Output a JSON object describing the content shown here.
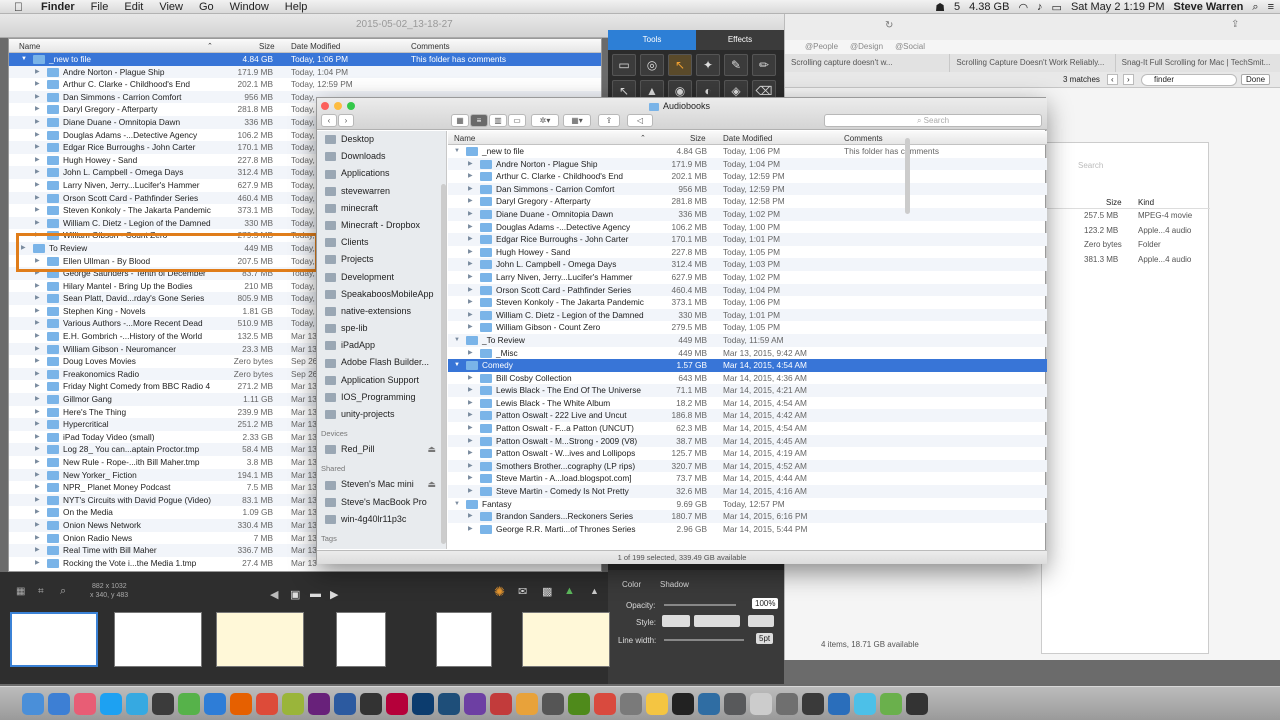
{
  "menubar": {
    "apple": "",
    "items": [
      "Finder",
      "File",
      "Edit",
      "View",
      "Go",
      "Window",
      "Help"
    ],
    "status": {
      "storage": "4.38 GB",
      "badge": "5",
      "date_time": "Sat May 2  1:19 PM",
      "user": "Steve Warren"
    }
  },
  "capture_title": "2015-05-02_13-18-27",
  "browser": {
    "bookmarks": [
      "@People",
      "@Design",
      "@Social"
    ],
    "tabs": [
      "Scrolling capture doesn't w...",
      "Scrolling Capture Doesn't Work Reliably...",
      "Snag-It Full Scrolling for Mac | TechSmit..."
    ],
    "find": {
      "matches": "3 matches",
      "query": "finder",
      "done": "Done"
    },
    "search_placeholder": "Search",
    "columns": {
      "size": "Size",
      "kind": "Kind"
    },
    "rows": [
      {
        "size": "257.5 MB",
        "kind": "MPEG-4 movie"
      },
      {
        "size": "123.2 MB",
        "kind": "Apple...4 audio"
      },
      {
        "size": "Zero bytes",
        "kind": "Folder"
      },
      {
        "size": "381.3 MB",
        "kind": "Apple...4 audio"
      }
    ],
    "footer": "4 items, 18.71 GB available"
  },
  "list_window": {
    "columns": {
      "name": "Name",
      "size": "Size",
      "date": "Date Modified",
      "comments": "Comments"
    },
    "rows": [
      {
        "name": "_new to file",
        "size": "4.84 GB",
        "date": "Today, 1:06 PM",
        "comment": "This folder has comments",
        "level": 0,
        "open": true,
        "sel": true
      },
      {
        "name": "Andre Norton - Plague Ship",
        "size": "171.9 MB",
        "date": "Today, 1:04 PM",
        "level": 1
      },
      {
        "name": "Arthur C. Clarke - Childhood's End",
        "size": "202.1 MB",
        "date": "Today, 12:59 PM",
        "level": 1
      },
      {
        "name": "Dan Simmons - Carrion Comfort",
        "size": "956 MB",
        "date": "Today,",
        "level": 1
      },
      {
        "name": "Daryl Gregory - Afterparty",
        "size": "281.8 MB",
        "date": "Today,",
        "level": 1
      },
      {
        "name": "Diane Duane - Omnitopia Dawn",
        "size": "336 MB",
        "date": "Today,",
        "level": 1
      },
      {
        "name": "Douglas Adams -...Detective Agency",
        "size": "106.2 MB",
        "date": "Today,",
        "level": 1
      },
      {
        "name": "Edgar Rice Burroughs - John Carter",
        "size": "170.1 MB",
        "date": "Today,",
        "level": 1
      },
      {
        "name": "Hugh Howey - Sand",
        "size": "227.8 MB",
        "date": "Today,",
        "level": 1
      },
      {
        "name": "John L. Campbell - Omega Days",
        "size": "312.4 MB",
        "date": "Today,",
        "level": 1
      },
      {
        "name": "Larry Niven, Jerry...Lucifer's Hammer",
        "size": "627.9 MB",
        "date": "Today,",
        "level": 1
      },
      {
        "name": "Orson Scott Card - Pathfinder Series",
        "size": "460.4 MB",
        "date": "Today,",
        "level": 1
      },
      {
        "name": "Steven Konkoly - The Jakarta Pandemic",
        "size": "373.1 MB",
        "date": "Today,",
        "level": 1
      },
      {
        "name": "William C. Dietz - Legion of the Damned",
        "size": "330 MB",
        "date": "Today,",
        "level": 1
      },
      {
        "name": "William Gibson - Count Zero",
        "size": "279.5 MB",
        "date": "Today,",
        "level": 1
      },
      {
        "name": "To Review",
        "size": "449 MB",
        "date": "Today,",
        "level": 0
      },
      {
        "name": "Ellen Ullman - By Blood",
        "size": "207.5 MB",
        "date": "Today,",
        "level": 1
      },
      {
        "name": "George Saunders - Tenth of December",
        "size": "83.7 MB",
        "date": "Today,",
        "level": 1
      },
      {
        "name": "Hilary Mantel - Bring Up the Bodies",
        "size": "210 MB",
        "date": "Today,",
        "level": 1
      },
      {
        "name": "Sean Platt, David...rday's Gone Series",
        "size": "805.9 MB",
        "date": "Today,",
        "level": 1
      },
      {
        "name": "Stephen King - Novels",
        "size": "1.81 GB",
        "date": "Today,",
        "level": 1
      },
      {
        "name": "Various Authors -...More Recent Dead",
        "size": "510.9 MB",
        "date": "Today,",
        "level": 1
      },
      {
        "name": "E.H. Gombrich -...History of the World",
        "size": "132.5 MB",
        "date": "Mar 13",
        "level": 1
      },
      {
        "name": "William Gibson - Neuromancer",
        "size": "23.3 MB",
        "date": "Mar 13",
        "level": 1
      },
      {
        "name": "Doug Loves Movies",
        "size": "Zero bytes",
        "date": "Sep 26",
        "level": 1
      },
      {
        "name": "Freakonomics Radio",
        "size": "Zero bytes",
        "date": "Sep 26",
        "level": 1
      },
      {
        "name": "Friday Night Comedy from BBC Radio 4",
        "size": "271.2 MB",
        "date": "Mar 13",
        "level": 1
      },
      {
        "name": "Gillmor Gang",
        "size": "1.11 GB",
        "date": "Mar 13",
        "level": 1
      },
      {
        "name": "Here's The Thing",
        "size": "239.9 MB",
        "date": "Mar 13",
        "level": 1
      },
      {
        "name": "Hypercritical",
        "size": "251.2 MB",
        "date": "Mar 13",
        "level": 1
      },
      {
        "name": "iPad Today Video (small)",
        "size": "2.33 GB",
        "date": "Mar 13",
        "level": 1
      },
      {
        "name": "Log 28_ You can...aptain Proctor.tmp",
        "size": "58.4 MB",
        "date": "Mar 13",
        "level": 1
      },
      {
        "name": "New Rule - Rope-...ith Bill Maher.tmp",
        "size": "3.8 MB",
        "date": "Mar 13",
        "level": 1
      },
      {
        "name": "New Yorker_ Fiction",
        "size": "194.1 MB",
        "date": "Mar 13",
        "level": 1
      },
      {
        "name": "NPR_ Planet Money Podcast",
        "size": "7.5 MB",
        "date": "Mar 13",
        "level": 1
      },
      {
        "name": "NYT's Circuits with David Pogue (Video)",
        "size": "83.1 MB",
        "date": "Mar 13",
        "level": 1
      },
      {
        "name": "On the Media",
        "size": "1.09 GB",
        "date": "Mar 13",
        "level": 1
      },
      {
        "name": "Onion News Network",
        "size": "330.4 MB",
        "date": "Mar 13",
        "level": 1
      },
      {
        "name": "Onion Radio News",
        "size": "7 MB",
        "date": "Mar 13",
        "level": 1
      },
      {
        "name": "Real Time with Bill Maher",
        "size": "336.7 MB",
        "date": "Mar 13",
        "level": 1
      },
      {
        "name": "Rocking the Vote i...the Media 1.tmp",
        "size": "27.4 MB",
        "date": "Mar 13",
        "level": 1
      }
    ]
  },
  "snagit": {
    "tabs": {
      "tools": "Tools",
      "effects": "Effects"
    },
    "tools": [
      "▭",
      "◎",
      "↖",
      "✦",
      "✎",
      "✏",
      "↖",
      "▲",
      "◉",
      "◐",
      "◈",
      "⌫"
    ],
    "props": {
      "color": "Color",
      "shadow": "Shadow",
      "opacity": "Opacity:",
      "opacity_val": "100%",
      "style": "Style:",
      "line_width": "Line width:",
      "line_val": "5pt"
    },
    "info": {
      "dims": "882 x 1032",
      "cursor": "x 340, y 483"
    }
  },
  "audiobooks": {
    "title": "Audiobooks",
    "search_placeholder": "Search",
    "sidebar": [
      {
        "type": "item",
        "label": "Desktop"
      },
      {
        "type": "item",
        "label": "Downloads"
      },
      {
        "type": "item",
        "label": "Applications"
      },
      {
        "type": "item",
        "label": "stevewarren"
      },
      {
        "type": "item",
        "label": "minecraft"
      },
      {
        "type": "item",
        "label": "Minecraft - Dropbox"
      },
      {
        "type": "item",
        "label": "Clients"
      },
      {
        "type": "item",
        "label": "Projects"
      },
      {
        "type": "item",
        "label": "Development"
      },
      {
        "type": "item",
        "label": "SpeakaboosMobileApp"
      },
      {
        "type": "item",
        "label": "native-extensions"
      },
      {
        "type": "item",
        "label": "spe-lib"
      },
      {
        "type": "item",
        "label": "iPadApp"
      },
      {
        "type": "item",
        "label": "Adobe Flash Builder..."
      },
      {
        "type": "item",
        "label": "Application Support"
      },
      {
        "type": "item",
        "label": "IOS_Programming"
      },
      {
        "type": "item",
        "label": "unity-projects"
      },
      {
        "type": "header",
        "label": "Devices"
      },
      {
        "type": "item",
        "label": "Red_Pill",
        "eject": true
      },
      {
        "type": "header",
        "label": "Shared"
      },
      {
        "type": "item",
        "label": "Steven's Mac mini",
        "eject": true
      },
      {
        "type": "item",
        "label": "Steve's MacBook Pro"
      },
      {
        "type": "item",
        "label": "win-4g40lr11p3c"
      },
      {
        "type": "header",
        "label": "Tags"
      }
    ],
    "columns": {
      "name": "Name",
      "size": "Size",
      "date": "Date Modified",
      "comments": "Comments"
    },
    "rows": [
      {
        "name": "_new to file",
        "size": "4.84 GB",
        "date": "Today, 1:06 PM",
        "comment": "This folder has comments",
        "level": 0,
        "open": true
      },
      {
        "name": "Andre Norton - Plague Ship",
        "size": "171.9 MB",
        "date": "Today, 1:04 PM",
        "level": 1
      },
      {
        "name": "Arthur C. Clarke - Childhood's End",
        "size": "202.1 MB",
        "date": "Today, 12:59 PM",
        "level": 1
      },
      {
        "name": "Dan Simmons - Carrion Comfort",
        "size": "956 MB",
        "date": "Today, 12:59 PM",
        "level": 1
      },
      {
        "name": "Daryl Gregory - Afterparty",
        "size": "281.8 MB",
        "date": "Today, 12:58 PM",
        "level": 1
      },
      {
        "name": "Diane Duane - Omnitopia Dawn",
        "size": "336 MB",
        "date": "Today, 1:02 PM",
        "level": 1
      },
      {
        "name": "Douglas Adams -...Detective Agency",
        "size": "106.2 MB",
        "date": "Today, 1:00 PM",
        "level": 1
      },
      {
        "name": "Edgar Rice Burroughs - John Carter",
        "size": "170.1 MB",
        "date": "Today, 1:01 PM",
        "level": 1
      },
      {
        "name": "Hugh Howey - Sand",
        "size": "227.8 MB",
        "date": "Today, 1:05 PM",
        "level": 1
      },
      {
        "name": "John L. Campbell - Omega Days",
        "size": "312.4 MB",
        "date": "Today, 1:03 PM",
        "level": 1
      },
      {
        "name": "Larry Niven, Jerry...Lucifer's Hammer",
        "size": "627.9 MB",
        "date": "Today, 1:02 PM",
        "level": 1
      },
      {
        "name": "Orson Scott Card - Pathfinder Series",
        "size": "460.4 MB",
        "date": "Today, 1:04 PM",
        "level": 1
      },
      {
        "name": "Steven Konkoly - The Jakarta Pandemic",
        "size": "373.1 MB",
        "date": "Today, 1:06 PM",
        "level": 1
      },
      {
        "name": "William C. Dietz - Legion of the Damned",
        "size": "330 MB",
        "date": "Today, 1:01 PM",
        "level": 1
      },
      {
        "name": "William Gibson - Count Zero",
        "size": "279.5 MB",
        "date": "Today, 1:05 PM",
        "level": 1
      },
      {
        "name": "_To Review",
        "size": "449 MB",
        "date": "Today, 11:59 AM",
        "level": 0,
        "open": true
      },
      {
        "name": "_Misc",
        "size": "449 MB",
        "date": "Mar 13, 2015, 9:42 AM",
        "level": 1
      },
      {
        "name": "Comedy",
        "size": "1.57 GB",
        "date": "Mar 14, 2015, 4:54 AM",
        "level": 0,
        "open": true,
        "sel": true
      },
      {
        "name": "Bill Cosby Collection",
        "size": "643 MB",
        "date": "Mar 14, 2015, 4:36 AM",
        "level": 1
      },
      {
        "name": "Lewis Black - The End Of The Universe",
        "size": "71.1 MB",
        "date": "Mar 14, 2015, 4:21 AM",
        "level": 1
      },
      {
        "name": "Lewis Black - The White Album",
        "size": "18.2 MB",
        "date": "Mar 14, 2015, 4:54 AM",
        "level": 1
      },
      {
        "name": "Patton Oswalt - 222 Live and Uncut",
        "size": "186.8 MB",
        "date": "Mar 14, 2015, 4:42 AM",
        "level": 1
      },
      {
        "name": "Patton Oswalt - F...a Patton (UNCUT)",
        "size": "62.3 MB",
        "date": "Mar 14, 2015, 4:54 AM",
        "level": 1
      },
      {
        "name": "Patton Oswalt - M...Strong - 2009 (V8)",
        "size": "38.7 MB",
        "date": "Mar 14, 2015, 4:45 AM",
        "level": 1
      },
      {
        "name": "Patton Oswalt - W...ives and Lollipops",
        "size": "125.7 MB",
        "date": "Mar 14, 2015, 4:19 AM",
        "level": 1
      },
      {
        "name": "Smothers Brother...cography (LP rips)",
        "size": "320.7 MB",
        "date": "Mar 14, 2015, 4:52 AM",
        "level": 1
      },
      {
        "name": "Steve Martin - A...load.blogspot.com]",
        "size": "73.7 MB",
        "date": "Mar 14, 2015, 4:44 AM",
        "level": 1
      },
      {
        "name": "Steve Martin - Comedy Is Not Pretty",
        "size": "32.6 MB",
        "date": "Mar 14, 2015, 4:16 AM",
        "level": 1
      },
      {
        "name": "Fantasy",
        "size": "9.69 GB",
        "date": "Today, 12:57 PM",
        "level": 0,
        "open": true
      },
      {
        "name": "Brandon Sanders...Reckoners Series",
        "size": "180.7 MB",
        "date": "Mar 14, 2015, 6:16 PM",
        "level": 1
      },
      {
        "name": "George R.R. Marti...of Thrones Series",
        "size": "2.96 GB",
        "date": "Mar 14, 2015, 5:44 PM",
        "level": 1
      }
    ],
    "status": "1 of 199 selected, 339.49 GB available"
  }
}
